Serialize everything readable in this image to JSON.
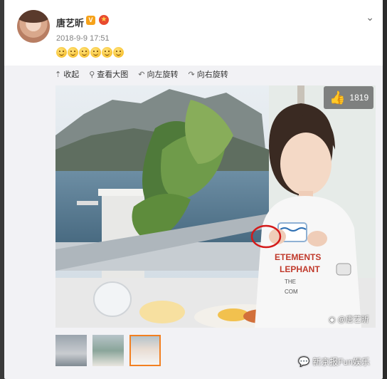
{
  "post": {
    "username": "唐艺昕",
    "verified_badge": "V",
    "medal_icon": "medal-icon",
    "timestamp": "2018-9-9 17:51",
    "emoji_count": 6,
    "more_icon": "chevron-down-icon"
  },
  "toolbar": {
    "collapse_label": "收起",
    "view_large_label": "查看大图",
    "rotate_left_label": "向左旋转",
    "rotate_right_label": "向右旋转"
  },
  "photo": {
    "like_count": "1819",
    "watermark": "@唐艺昕",
    "print_text_line1": "ETEMENTS",
    "print_text_line2": "LEPHANT",
    "print_text_line3": "THE",
    "print_text_line4": "COM"
  },
  "thumbnails": [
    {
      "id": "thumb-1",
      "selected": false
    },
    {
      "id": "thumb-2",
      "selected": false
    },
    {
      "id": "thumb-3",
      "selected": true
    }
  ],
  "footer": {
    "brand": "新京报Fun娱乐"
  },
  "colors": {
    "accent": "#f28021",
    "badge": "#f6a21a",
    "annotation": "#d41a1a"
  }
}
